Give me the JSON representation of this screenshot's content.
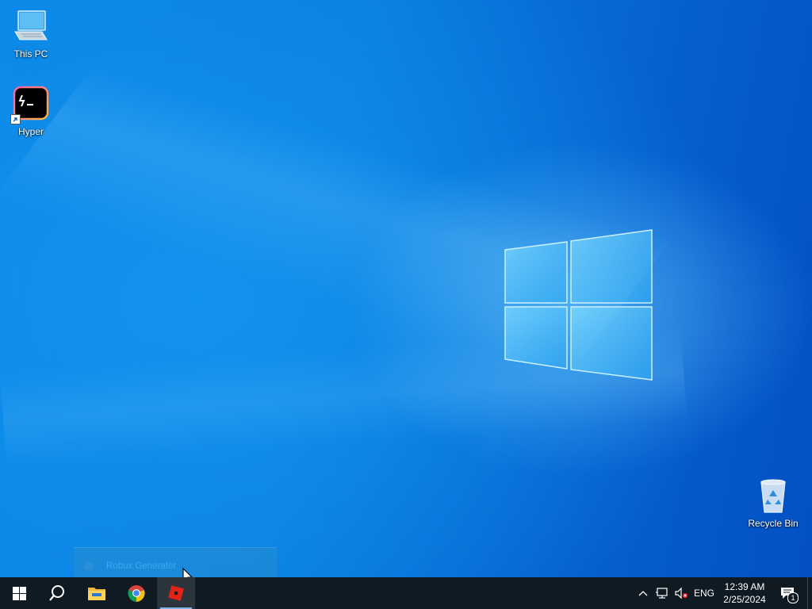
{
  "desktop": {
    "icons": [
      {
        "label": "This PC",
        "icon": "computer-icon"
      },
      {
        "label": "Hyper",
        "icon": "terminal-icon",
        "shortcut": true
      },
      {
        "label": "Recycle Bin",
        "icon": "recycle-bin-icon"
      }
    ],
    "wallpaper": "windows-10-hero",
    "colors": {
      "accent": "#0a78d8",
      "taskbar": "#0f1a22"
    }
  },
  "preview": {
    "title": "Robux Generator",
    "icon": "roblox-icon"
  },
  "taskbar": {
    "start_icon": "windows-icon",
    "search_icon": "search-icon",
    "pinned": [
      {
        "name": "File Explorer",
        "icon": "folder-icon",
        "running": false
      },
      {
        "name": "Google Chrome",
        "icon": "chrome-icon",
        "running": false
      },
      {
        "name": "Roblox",
        "icon": "roblox-icon",
        "running": true,
        "active": true
      }
    ],
    "tray": {
      "chevron_icon": "chevron-up-icon",
      "network_icon": "network-disconnected-icon",
      "volume_icon": "volume-muted-icon",
      "language": "ENG",
      "time": "12:39 AM",
      "date": "2/25/2024",
      "notification_count": "1"
    }
  }
}
